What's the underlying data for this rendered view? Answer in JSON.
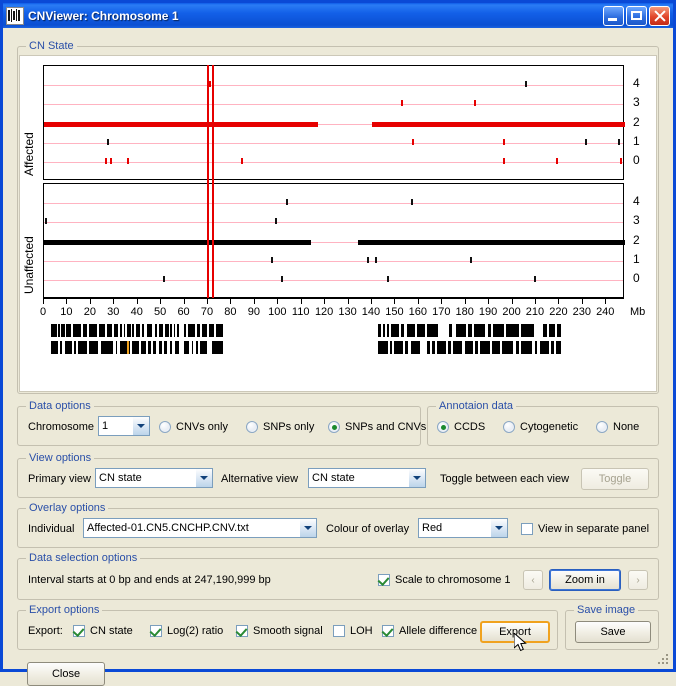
{
  "window": {
    "title": "CNViewer: Chromosome 1",
    "icon": "chromosome-icon",
    "minimize_label": "Minimize",
    "maximize_label": "Maximize",
    "close_label": "Close"
  },
  "plot_group": {
    "title": "CN State"
  },
  "chart_data": {
    "type": "line",
    "title": "CN State",
    "xlabel": "Mb",
    "ylabel": "",
    "xlim": [
      0,
      248
    ],
    "xticks": [
      0,
      10,
      20,
      30,
      40,
      50,
      60,
      70,
      80,
      90,
      100,
      110,
      120,
      130,
      140,
      150,
      160,
      170,
      180,
      190,
      200,
      210,
      220,
      230,
      240
    ],
    "xtick_labels": [
      "0",
      "10",
      "20",
      "30",
      "40",
      "50",
      "60",
      "70",
      "80",
      "90",
      "100",
      "110",
      "120",
      "130",
      "140",
      "150",
      "160",
      "170",
      "180",
      "190",
      "200",
      "210",
      "220",
      "230",
      "240"
    ],
    "x_unit_label": "Mb",
    "panels": [
      {
        "name": "Affected",
        "ylabel": "Affected",
        "ylim": [
          0,
          4
        ],
        "yticks": [
          4,
          3,
          2,
          1,
          0
        ],
        "baseline_level": 2,
        "baseline_color": "#e60000",
        "gridline_color": "#ffb3c1",
        "segments": [
          {
            "start": 0,
            "end": 117,
            "level": 2
          },
          {
            "start": 140,
            "end": 248,
            "level": 2
          }
        ],
        "markers": [
          {
            "x": 70.5,
            "level": 4,
            "color": "#e60000"
          },
          {
            "x": 27.0,
            "level": 1,
            "color": "#111111"
          },
          {
            "x": 196.0,
            "level": 1,
            "color": "#e60000"
          },
          {
            "x": 26.0,
            "level": 0,
            "color": "#e60000"
          },
          {
            "x": 28.0,
            "level": 0,
            "color": "#e60000"
          },
          {
            "x": 35.5,
            "level": 0,
            "color": "#e60000"
          },
          {
            "x": 84.0,
            "level": 0,
            "color": "#e60000"
          },
          {
            "x": 196.0,
            "level": 0,
            "color": "#e60000"
          },
          {
            "x": 152.5,
            "level": 3,
            "color": "#e60000"
          },
          {
            "x": 183.5,
            "level": 3,
            "color": "#e60000"
          },
          {
            "x": 205.5,
            "level": 4,
            "color": "#111111"
          },
          {
            "x": 157.0,
            "level": 1,
            "color": "#e60000"
          },
          {
            "x": 231.0,
            "level": 1,
            "color": "#111111"
          },
          {
            "x": 245.0,
            "level": 1,
            "color": "#111111"
          },
          {
            "x": 218.5,
            "level": 0,
            "color": "#e60000"
          },
          {
            "x": 246.0,
            "level": 0,
            "color": "#e60000"
          }
        ]
      },
      {
        "name": "Unaffected",
        "ylabel": "Unaffected",
        "ylim": [
          0,
          4
        ],
        "yticks": [
          4,
          3,
          2,
          1,
          0
        ],
        "baseline_level": 2,
        "baseline_color": "#000000",
        "gridline_color": "#ffb3c1",
        "segments": [
          {
            "start": 0,
            "end": 114,
            "level": 2
          },
          {
            "start": 134,
            "end": 248,
            "level": 2
          }
        ],
        "markers": [
          {
            "x": 103.5,
            "level": 4,
            "color": "#111111"
          },
          {
            "x": 156.5,
            "level": 4,
            "color": "#111111"
          },
          {
            "x": 98.5,
            "level": 3,
            "color": "#111111"
          },
          {
            "x": 0.4,
            "level": 3,
            "color": "#111111"
          },
          {
            "x": 97.0,
            "level": 1,
            "color": "#111111"
          },
          {
            "x": 138.0,
            "level": 1,
            "color": "#111111"
          },
          {
            "x": 141.5,
            "level": 1,
            "color": "#111111"
          },
          {
            "x": 182.0,
            "level": 1,
            "color": "#111111"
          },
          {
            "x": 51.0,
            "level": 0,
            "color": "#111111"
          },
          {
            "x": 101.0,
            "level": 0,
            "color": "#111111"
          },
          {
            "x": 146.5,
            "level": 0,
            "color": "#111111"
          },
          {
            "x": 209.0,
            "level": 0,
            "color": "#111111"
          }
        ]
      }
    ],
    "overlay_vlines": [
      {
        "x": 70.2,
        "color": "#e60000"
      },
      {
        "x": 72.2,
        "color": "#e60000"
      }
    ],
    "annotation_track": {
      "name": "CCDS",
      "rows": [
        [
          [
            3.5,
            5.8
          ],
          [
            6.4,
            7.2
          ],
          [
            7.8,
            9.2
          ],
          [
            9.8,
            11.8
          ],
          [
            12.6,
            16.2
          ],
          [
            17.2,
            19.0
          ],
          [
            19.8,
            23.0
          ],
          [
            24.0,
            26.6
          ],
          [
            27.4,
            29.4
          ],
          [
            30.4,
            32.0
          ],
          [
            32.8,
            33.6
          ],
          [
            34.4,
            35.2
          ],
          [
            36.0,
            37.4
          ],
          [
            38.2,
            38.9
          ],
          [
            39.6,
            41.6
          ],
          [
            42.4,
            43.2
          ],
          [
            44.6,
            46.6
          ],
          [
            48.0,
            48.8
          ],
          [
            49.6,
            51.2
          ],
          [
            52.0,
            53.6
          ],
          [
            54.4,
            55.0
          ],
          [
            55.8,
            56.4
          ],
          [
            57.2,
            58.2
          ],
          [
            60.0,
            61.0
          ],
          [
            62.0,
            64.8
          ],
          [
            65.6,
            67.0
          ],
          [
            68.0,
            70.0
          ],
          [
            70.8,
            73.0
          ],
          [
            73.8,
            76.8
          ],
          [
            143.0,
            144.2
          ],
          [
            145.0,
            146.0
          ],
          [
            146.8,
            147.6
          ],
          [
            148.6,
            152.0
          ],
          [
            153.0,
            154.2
          ],
          [
            155.2,
            158.8
          ],
          [
            159.8,
            163.0
          ],
          [
            164.0,
            168.6
          ],
          [
            173.4,
            174.6
          ],
          [
            176.4,
            180.6
          ],
          [
            181.6,
            183.0
          ],
          [
            184.0,
            188.8
          ],
          [
            189.8,
            191.2
          ],
          [
            192.2,
            196.8
          ],
          [
            197.8,
            203.0
          ],
          [
            204.0,
            209.6
          ],
          [
            213.4,
            215.0
          ],
          [
            216.0,
            218.6
          ],
          [
            219.6,
            221.0
          ]
        ],
        [
          [
            3.6,
            6.2
          ],
          [
            7.4,
            8.2
          ],
          [
            9.2,
            12.4
          ],
          [
            13.4,
            14.0
          ],
          [
            15.0,
            18.6
          ],
          [
            19.6,
            23.6
          ],
          [
            24.6,
            30.0
          ],
          [
            31.0,
            31.8
          ],
          [
            32.8,
            37.0
          ],
          [
            38.0,
            40.8
          ],
          [
            41.8,
            44.0
          ],
          [
            45.0,
            46.0
          ],
          [
            47.0,
            48.4
          ],
          [
            49.4,
            50.6
          ],
          [
            51.6,
            53.0
          ],
          [
            54.0,
            55.2
          ],
          [
            56.2,
            58.0
          ],
          [
            60.0,
            62.4
          ],
          [
            63.4,
            64.2
          ],
          [
            65.2,
            66.0
          ],
          [
            67.0,
            69.8
          ],
          [
            72.0,
            76.8
          ],
          [
            143.0,
            147.2
          ],
          [
            148.2,
            149.0
          ],
          [
            150.0,
            153.6
          ],
          [
            154.6,
            156.0
          ],
          [
            157.0,
            160.8
          ],
          [
            164.0,
            165.0
          ],
          [
            166.0,
            167.2
          ],
          [
            168.2,
            172.0
          ],
          [
            173.0,
            174.2
          ],
          [
            175.2,
            178.8
          ],
          [
            180.0,
            183.4
          ],
          [
            184.4,
            185.6
          ],
          [
            186.6,
            190.8
          ],
          [
            191.8,
            195.0
          ],
          [
            196.0,
            200.8
          ],
          [
            201.8,
            203.0
          ],
          [
            204.0,
            208.8
          ],
          [
            209.8,
            211.0
          ],
          [
            212.0,
            215.8
          ],
          [
            216.8,
            218.0
          ],
          [
            219.0,
            221.0
          ]
        ]
      ],
      "highlight": {
        "x": 36.0,
        "row": 1,
        "color": "#f0a21e"
      }
    }
  },
  "data_options": {
    "title": "Data options",
    "chromosome_label": "Chromosome",
    "chromosome_value": "1",
    "radios": [
      {
        "label": "CNVs only",
        "selected": false
      },
      {
        "label": "SNPs only",
        "selected": false
      },
      {
        "label": "SNPs and CNVs",
        "selected": true
      }
    ]
  },
  "annotation_data": {
    "title": "Annotaion data",
    "radios": [
      {
        "label": "CCDS",
        "selected": true
      },
      {
        "label": "Cytogenetic",
        "selected": false
      },
      {
        "label": "None",
        "selected": false
      }
    ]
  },
  "view_options": {
    "title": "View options",
    "primary_label": "Primary view",
    "primary_value": "CN state",
    "alternative_label": "Alternative view",
    "alternative_value": "CN state",
    "toggle_hint": "Toggle between each view",
    "toggle_button": "Toggle"
  },
  "overlay_options": {
    "title": "Overlay options",
    "individual_label": "Individual",
    "individual_value": "Affected-01.CN5.CNCHP.CNV.txt",
    "colour_label": "Colour of overlay",
    "colour_value": "Red",
    "separate_panel_label": "View in separate panel",
    "separate_panel_checked": false
  },
  "data_selection": {
    "title": "Data selection options",
    "interval_text": "Interval starts at 0 bp and ends at 247,190,999 bp",
    "scale_label": "Scale to chromosome 1",
    "scale_checked": true,
    "prev_label": "‹",
    "next_label": "›",
    "zoom_in_label": "Zoom in"
  },
  "export_options": {
    "title": "Export options",
    "export_label": "Export:",
    "checks": [
      {
        "label": "CN state",
        "checked": true
      },
      {
        "label": "Log(2) ratio",
        "checked": true
      },
      {
        "label": "Smooth signal",
        "checked": true
      },
      {
        "label": "LOH",
        "checked": false
      },
      {
        "label": "Allele difference",
        "checked": true
      }
    ],
    "export_button": "Export"
  },
  "save_image": {
    "title": "Save image",
    "save_button": "Save"
  },
  "footer": {
    "close_button": "Close"
  },
  "colors": {
    "accent": "#e60000",
    "grid": "#ffb3c1",
    "title_blue": "#0a49d6",
    "group_label": "#2a4fa8",
    "hover": "#f0a21e"
  }
}
